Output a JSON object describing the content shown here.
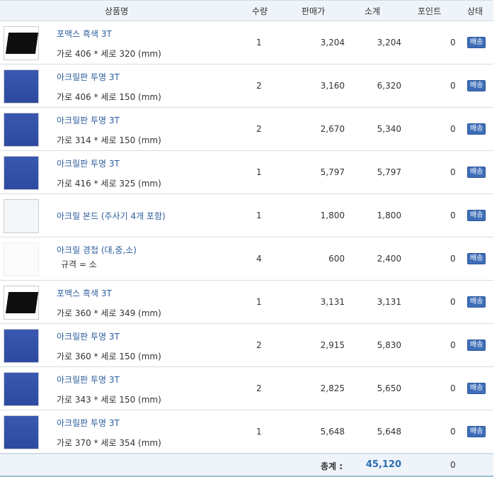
{
  "header": {
    "product": "상품명",
    "qty": "수량",
    "price": "판매가",
    "subtotal": "소계",
    "point": "포인트",
    "status": "상태"
  },
  "rows": [
    {
      "name": "포맥스 흑색 3T",
      "option": "가로 406 * 세로 320 (mm)",
      "qty": "1",
      "price": "3,204",
      "subtotal": "3,204",
      "point": "0",
      "status": "배송",
      "thumb": "black"
    },
    {
      "name": "아크릴판 투명 3T",
      "option": "가로 406 * 세로 150 (mm)",
      "qty": "2",
      "price": "3,160",
      "subtotal": "6,320",
      "point": "0",
      "status": "배송",
      "thumb": "blue"
    },
    {
      "name": "아크릴판 투명 3T",
      "option": "가로 314 * 세로 150 (mm)",
      "qty": "2",
      "price": "2,670",
      "subtotal": "5,340",
      "point": "0",
      "status": "배송",
      "thumb": "blue"
    },
    {
      "name": "아크릴판 투명 3T",
      "option": "가로 416 * 세로 325 (mm)",
      "qty": "1",
      "price": "5,797",
      "subtotal": "5,797",
      "point": "0",
      "status": "배송",
      "thumb": "blue"
    },
    {
      "name": "아크릴 본드 (주사기 4개 포함)",
      "option": "",
      "qty": "1",
      "price": "1,800",
      "subtotal": "1,800",
      "point": "0",
      "status": "배송",
      "thumb": "bond"
    },
    {
      "name": "아크릴 경첩 (대,중,소)",
      "option": "규격 = 소",
      "qty": "4",
      "price": "600",
      "subtotal": "2,400",
      "point": "0",
      "status": "배송",
      "thumb": "blank"
    },
    {
      "name": "포맥스 흑색 3T",
      "option": "가로 360 * 세로 349 (mm)",
      "qty": "1",
      "price": "3,131",
      "subtotal": "3,131",
      "point": "0",
      "status": "배송",
      "thumb": "black"
    },
    {
      "name": "아크릴판 투명 3T",
      "option": "가로 360 * 세로 150 (mm)",
      "qty": "2",
      "price": "2,915",
      "subtotal": "5,830",
      "point": "0",
      "status": "배송",
      "thumb": "blue"
    },
    {
      "name": "아크릴판 투명 3T",
      "option": "가로 343 * 세로 150 (mm)",
      "qty": "2",
      "price": "2,825",
      "subtotal": "5,650",
      "point": "0",
      "status": "배송",
      "thumb": "blue"
    },
    {
      "name": "아크릴판 투명 3T",
      "option": "가로 370 * 세로 354 (mm)",
      "qty": "1",
      "price": "5,648",
      "subtotal": "5,648",
      "point": "0",
      "status": "배송",
      "thumb": "blue"
    }
  ],
  "total": {
    "label": "총계 :",
    "amount": "45,120",
    "point": "0"
  }
}
